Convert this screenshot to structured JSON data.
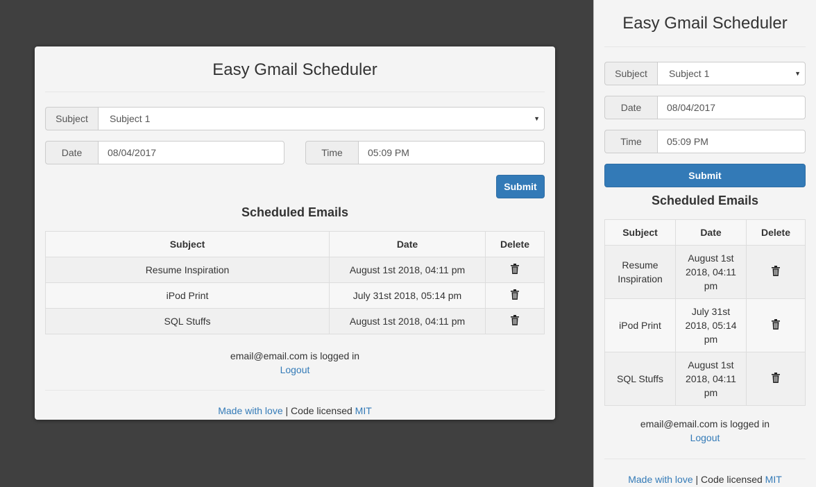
{
  "app": {
    "title": "Easy Gmail Scheduler"
  },
  "form": {
    "subject_label": "Subject",
    "subject_value": "Subject 1",
    "date_label": "Date",
    "date_value": "08/04/2017",
    "time_label": "Time",
    "time_value": "05:09 PM",
    "submit_label": "Submit"
  },
  "scheduled": {
    "heading": "Scheduled Emails",
    "columns": [
      "Subject",
      "Date",
      "Delete"
    ],
    "rows": [
      {
        "subject": "Resume Inspiration",
        "date": "August 1st 2018, 04:11 pm"
      },
      {
        "subject": "iPod Print",
        "date": "July 31st 2018, 05:14 pm"
      },
      {
        "subject": "SQL Stuffs",
        "date": "August 1st 2018, 04:11 pm"
      }
    ],
    "delete_icon": "trash-icon"
  },
  "session": {
    "logged_in_text": "email@email.com is logged in",
    "logout_label": "Logout"
  },
  "footer": {
    "made_with_love": "Made with love",
    "separator_text": " | Code licensed ",
    "license_link": "MIT"
  },
  "colors": {
    "background": "#404040",
    "panel": "#f4f4f4",
    "primary": "#337ab7",
    "link": "#337ab7"
  }
}
